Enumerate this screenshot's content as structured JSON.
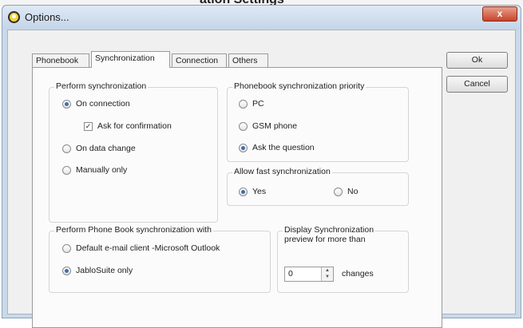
{
  "header_fragment": "ation Settings",
  "window": {
    "title": "Options...",
    "close_glyph": "x"
  },
  "tabs": [
    {
      "label": "Phonebook"
    },
    {
      "label": "Synchronization"
    },
    {
      "label": "Connection"
    },
    {
      "label": "Others"
    }
  ],
  "buttons": {
    "ok": "Ok",
    "cancel": "Cancel"
  },
  "perform_sync": {
    "title": "Perform synchronization",
    "on_connection": "On connection",
    "ask_confirmation": "Ask for confirmation",
    "ask_confirmation_checked": true,
    "on_data_change": "On data change",
    "manually_only": "Manually only",
    "selected": "On connection"
  },
  "priority": {
    "title": "Phonebook synchronization priority",
    "pc": "PC",
    "gsm": "GSM phone",
    "ask": "Ask the question",
    "selected": "Ask the question"
  },
  "fast_sync": {
    "title": "Allow fast synchronization",
    "yes": "Yes",
    "no": "No",
    "selected": "Yes"
  },
  "phonebook_with": {
    "title": "Perform Phone Book synchronization with",
    "default_client": "Default e-mail client -Microsoft Outlook",
    "jablo": "JabloSuite only",
    "selected": "JabloSuite only"
  },
  "preview": {
    "title_line1": "Display Synchronization",
    "title_line2": "preview for more than",
    "value": "0",
    "unit": "changes"
  },
  "icons": {
    "app": "app-icon",
    "close": "close-icon"
  }
}
